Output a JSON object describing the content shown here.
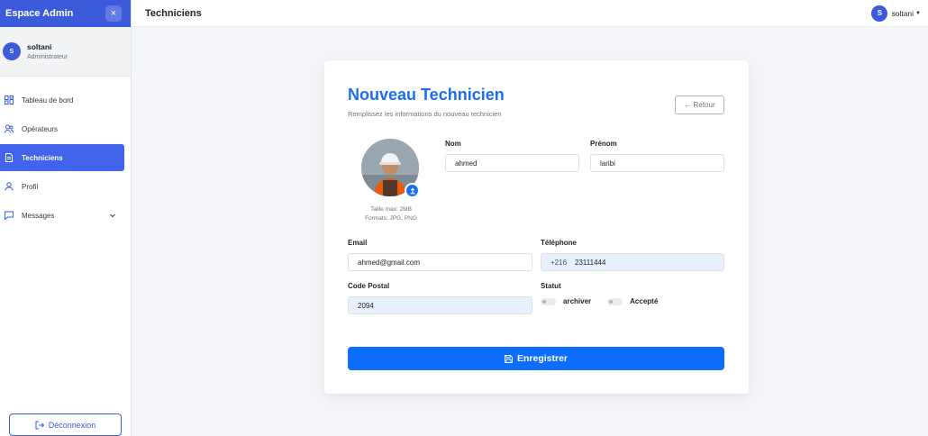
{
  "sidebar": {
    "brand": "Espace Admin",
    "close_glyph": "×",
    "user": {
      "initial": "S",
      "name": "soltani",
      "role": "Administrateur"
    },
    "items": [
      {
        "label": "Tableau de bord",
        "icon": "dashboard-icon"
      },
      {
        "label": "Opérateurs",
        "icon": "users-icon"
      },
      {
        "label": "Techniciens",
        "icon": "document-icon",
        "active": true
      },
      {
        "label": "Profil",
        "icon": "user-icon"
      },
      {
        "label": "Messages",
        "icon": "chat-icon"
      }
    ],
    "logout_label": "Déconnexion"
  },
  "header": {
    "title": "Techniciens",
    "user_initial": "S",
    "user_name": "soltani"
  },
  "form": {
    "title": "Nouveau Technicien",
    "subtitle": "Remplissez les informations du nouveau technicien",
    "back_label": "← Retour",
    "photo_max": "Taille max: 2MB",
    "photo_formats": "Formats: JPG, PNG",
    "nom_label": "Nom",
    "nom_value": "ahmed",
    "prenom_label": "Prénom",
    "prenom_value": "laribi",
    "email_label": "Email",
    "email_value": "ahmed@gmail.com",
    "phone_label": "Téléphone",
    "phone_prefix": "+216",
    "phone_value": "23111444",
    "postal_label": "Code Postal",
    "postal_value": "2094",
    "statut_label": "Statut",
    "toggle_archiver": "archiver",
    "toggle_accepte": "Accepté",
    "save_label": "Enregistrer"
  },
  "colors": {
    "brand": "#3b5bdb",
    "accent": "#1a6ef5",
    "primary_button": "#0d6efd",
    "autofill": "#e8f0fe"
  }
}
